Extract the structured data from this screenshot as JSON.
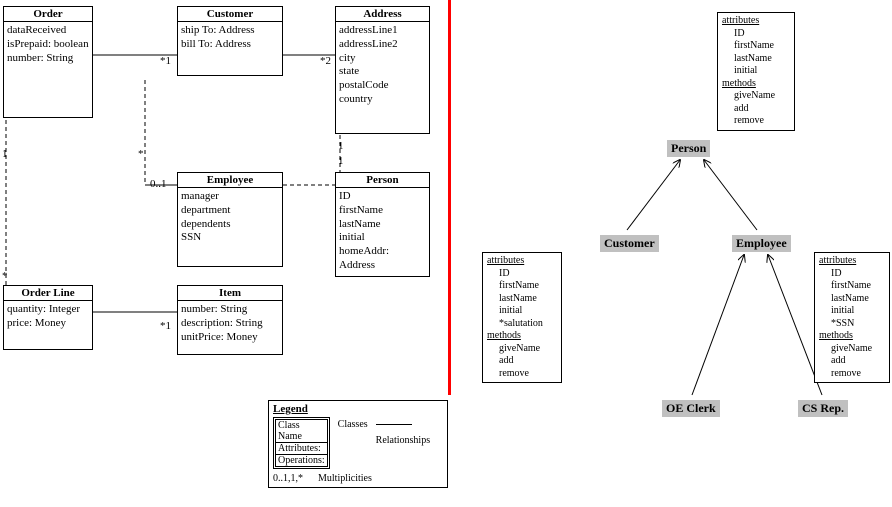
{
  "left": {
    "order": {
      "title": "Order",
      "attrs": "dataReceived\nisPrepaid: boolean\nnumber: String"
    },
    "customer": {
      "title": "Customer",
      "attrs": "ship To: Address\nbill To: Address"
    },
    "address": {
      "title": "Address",
      "attrs": "addressLine1\naddressLine2\ncity\nstate\npostalCode\ncountry"
    },
    "employee": {
      "title": "Employee",
      "attrs": "manager\ndepartment\ndependents\nSSN"
    },
    "person": {
      "title": "Person",
      "attrs": "ID\nfirstName\nlastName\ninitial\nhomeAddr:\nAddress"
    },
    "orderline": {
      "title": "Order Line",
      "attrs": "quantity: Integer\nprice: Money"
    },
    "item": {
      "title": "Item",
      "attrs": "number: String\ndescription: String\nunitPrice: Money"
    },
    "mult": {
      "star1a": "*1",
      "star2": "*2",
      "one_a": "1",
      "star_b": "*",
      "zero_one": "0..1",
      "one_c": "1",
      "one_d": "1",
      "star_e": "*",
      "star1b": "*1"
    },
    "legend": {
      "title": "Legend",
      "mini": [
        "Class Name",
        "Attributes:",
        "Operations:"
      ],
      "classes": "Classes",
      "relationships": "Relationships",
      "mults": "0..1,1,*",
      "multlabel": "Multiplicities"
    }
  },
  "right": {
    "person": "Person",
    "customer": "Customer",
    "employee": "Employee",
    "oeclerk": "OE Clerk",
    "csrep": "CS Rep.",
    "meta_person": {
      "attr_hdr": "attributes",
      "attrs": "ID\nfirstName\nlastName\ninitial",
      "meth_hdr": "methods",
      "meths": "giveName\nadd\nremove"
    },
    "meta_customer": {
      "attr_hdr": "attributes",
      "attrs": "ID\nfirstName\nlastName\ninitial\n*salutation",
      "meth_hdr": "methods",
      "meths": "giveName\nadd\nremove"
    },
    "meta_employee": {
      "attr_hdr": "attributes",
      "attrs": "ID\nfirstName\nlastName\ninitial\n*SSN",
      "meth_hdr": "methods",
      "meths": "giveName\nadd\nremove"
    }
  }
}
